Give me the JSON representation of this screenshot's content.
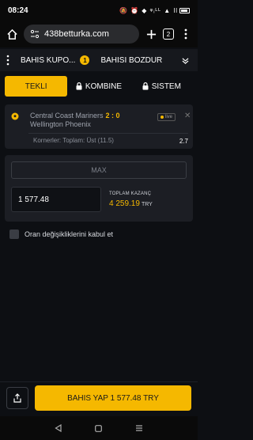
{
  "status_bar": {
    "time": "08:24",
    "icons": "🔕 ⏰ ◆ ᵠᵢᴸᴸ ▲ ll"
  },
  "browser": {
    "url": "438betturka.com",
    "tabs_count": "2"
  },
  "slip_header": {
    "tabs": [
      {
        "label": "BAHIS KUPO...",
        "badge": "1"
      },
      {
        "label": "BAHISI BOZDUR"
      }
    ]
  },
  "mode_tabs": [
    {
      "label": "TEKLI",
      "active": true
    },
    {
      "label": "KOMBINE",
      "locked": true
    },
    {
      "label": "SISTEM",
      "locked": true
    }
  ],
  "bet": {
    "home": "Central Coast Mariners",
    "score": "2 : 0",
    "away": "Wellington Phoenix",
    "live": "live",
    "market": "Kornerler: Toplam: Üst (11.5)",
    "odds": "2.7"
  },
  "stake": {
    "max_label": "MAX",
    "amount": "1 577.48",
    "payout_label": "TOPLAM KAZANÇ",
    "payout_value": "4 259.19",
    "currency": "TRY"
  },
  "accept_odds_change": {
    "label": "Oran değişikliklerini kabul et",
    "checked": false
  },
  "place_bet": {
    "label": "BAHIS YAP 1 577.48 TRY"
  },
  "colors": {
    "accent": "#f5b800",
    "background": "#0d0f13",
    "card": "#1c1e24"
  }
}
